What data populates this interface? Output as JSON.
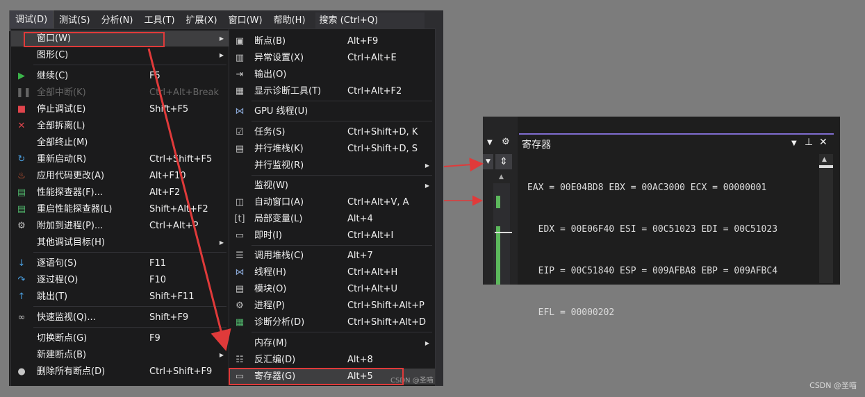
{
  "menubar": {
    "items": [
      "调试(D)",
      "测试(S)",
      "分析(N)",
      "工具(T)",
      "扩展(X)",
      "窗口(W)",
      "帮助(H)"
    ],
    "search": "搜索 (Ctrl+Q)"
  },
  "debug_menu": {
    "items": [
      {
        "label": "窗口(W)",
        "shortcut": "",
        "icon": "",
        "submenu": true,
        "disabled": false
      },
      {
        "label": "图形(C)",
        "shortcut": "",
        "icon": "",
        "submenu": true,
        "disabled": false
      },
      {
        "label": "继续(C)",
        "shortcut": "F5",
        "icon": "play-icon",
        "submenu": false,
        "disabled": false
      },
      {
        "label": "全部中断(K)",
        "shortcut": "Ctrl+Alt+Break",
        "icon": "pause-icon",
        "submenu": false,
        "disabled": true
      },
      {
        "label": "停止调试(E)",
        "shortcut": "Shift+F5",
        "icon": "stop-icon",
        "submenu": false,
        "disabled": false
      },
      {
        "label": "全部拆离(L)",
        "shortcut": "",
        "icon": "close-icon",
        "submenu": false,
        "disabled": false
      },
      {
        "label": "全部终止(M)",
        "shortcut": "",
        "icon": "",
        "submenu": false,
        "disabled": false
      },
      {
        "label": "重新启动(R)",
        "shortcut": "Ctrl+Shift+F5",
        "icon": "restart-icon",
        "submenu": false,
        "disabled": false
      },
      {
        "label": "应用代码更改(A)",
        "shortcut": "Alt+F10",
        "icon": "hot-reload-icon",
        "submenu": false,
        "disabled": false
      },
      {
        "label": "性能探查器(F)...",
        "shortcut": "Alt+F2",
        "icon": "profiler-icon",
        "submenu": false,
        "disabled": false
      },
      {
        "label": "重启性能探查器(L)",
        "shortcut": "Shift+Alt+F2",
        "icon": "profiler-restart-icon",
        "submenu": false,
        "disabled": false
      },
      {
        "label": "附加到进程(P)...",
        "shortcut": "Ctrl+Alt+P",
        "icon": "attach-icon",
        "submenu": false,
        "disabled": false
      },
      {
        "label": "其他调试目标(H)",
        "shortcut": "",
        "icon": "",
        "submenu": true,
        "disabled": false
      },
      {
        "label": "逐语句(S)",
        "shortcut": "F11",
        "icon": "step-into-icon",
        "submenu": false,
        "disabled": false
      },
      {
        "label": "逐过程(O)",
        "shortcut": "F10",
        "icon": "step-over-icon",
        "submenu": false,
        "disabled": false
      },
      {
        "label": "跳出(T)",
        "shortcut": "Shift+F11",
        "icon": "step-out-icon",
        "submenu": false,
        "disabled": false
      },
      {
        "label": "快速监视(Q)...",
        "shortcut": "Shift+F9",
        "icon": "glasses-icon",
        "submenu": false,
        "disabled": false
      },
      {
        "label": "切换断点(G)",
        "shortcut": "F9",
        "icon": "",
        "submenu": false,
        "disabled": false
      },
      {
        "label": "新建断点(B)",
        "shortcut": "",
        "icon": "",
        "submenu": true,
        "disabled": false
      },
      {
        "label": "删除所有断点(D)",
        "shortcut": "Ctrl+Shift+F9",
        "icon": "delete-breakpoints-icon",
        "submenu": false,
        "disabled": false
      }
    ]
  },
  "window_submenu": {
    "items": [
      {
        "label": "断点(B)",
        "shortcut": "Alt+F9",
        "icon": "breakpoints-icon",
        "submenu": false
      },
      {
        "label": "异常设置(X)",
        "shortcut": "Ctrl+Alt+E",
        "icon": "exception-icon",
        "submenu": false
      },
      {
        "label": "输出(O)",
        "shortcut": "",
        "icon": "output-icon",
        "submenu": false
      },
      {
        "label": "显示诊断工具(T)",
        "shortcut": "Ctrl+Alt+F2",
        "icon": "diagnostics-icon",
        "submenu": false
      },
      {
        "label": "GPU 线程(U)",
        "shortcut": "",
        "icon": "gpu-threads-icon",
        "submenu": false
      },
      {
        "label": "任务(S)",
        "shortcut": "Ctrl+Shift+D, K",
        "icon": "tasks-icon",
        "submenu": false
      },
      {
        "label": "并行堆栈(K)",
        "shortcut": "Ctrl+Shift+D, S",
        "icon": "parallel-stacks-icon",
        "submenu": false
      },
      {
        "label": "并行监视(R)",
        "shortcut": "",
        "icon": "",
        "submenu": true
      },
      {
        "label": "监视(W)",
        "shortcut": "",
        "icon": "",
        "submenu": true
      },
      {
        "label": "自动窗口(A)",
        "shortcut": "Ctrl+Alt+V, A",
        "icon": "autos-icon",
        "submenu": false
      },
      {
        "label": "局部变量(L)",
        "shortcut": "Alt+4",
        "icon": "locals-icon",
        "submenu": false
      },
      {
        "label": "即时(I)",
        "shortcut": "Ctrl+Alt+I",
        "icon": "immediate-icon",
        "submenu": false
      },
      {
        "label": "调用堆栈(C)",
        "shortcut": "Alt+7",
        "icon": "call-stack-icon",
        "submenu": false
      },
      {
        "label": "线程(H)",
        "shortcut": "Ctrl+Alt+H",
        "icon": "threads-icon",
        "submenu": false
      },
      {
        "label": "模块(O)",
        "shortcut": "Ctrl+Alt+U",
        "icon": "modules-icon",
        "submenu": false
      },
      {
        "label": "进程(P)",
        "shortcut": "Ctrl+Shift+Alt+P",
        "icon": "processes-icon",
        "submenu": false
      },
      {
        "label": "诊断分析(D)",
        "shortcut": "Ctrl+Shift+Alt+D",
        "icon": "diag-analysis-icon",
        "submenu": false
      },
      {
        "label": "内存(M)",
        "shortcut": "",
        "icon": "",
        "submenu": true
      },
      {
        "label": "反汇编(D)",
        "shortcut": "Alt+8",
        "icon": "disassembly-icon",
        "submenu": false
      },
      {
        "label": "寄存器(G)",
        "shortcut": "Alt+5",
        "icon": "registers-icon",
        "submenu": false
      }
    ]
  },
  "watermark": "CSDN @圣喵",
  "registers_window": {
    "title": "寄存器",
    "lines": [
      "EAX = 00E04BD8 EBX = 00AC3000 ECX = 00000001",
      "  EDX = 00E06F40 ESI = 00C51023 EDI = 00C51023",
      "  EIP = 00C51840 ESP = 009AFBA8 EBP = 009AFBC4",
      "  EFL = 00000202"
    ]
  },
  "corner_watermark": "CSDN @圣喵",
  "colors": {
    "highlight_box": "#e03a3a",
    "arrow": "#e03a3a",
    "tab_accent": "#7f6ccf"
  }
}
